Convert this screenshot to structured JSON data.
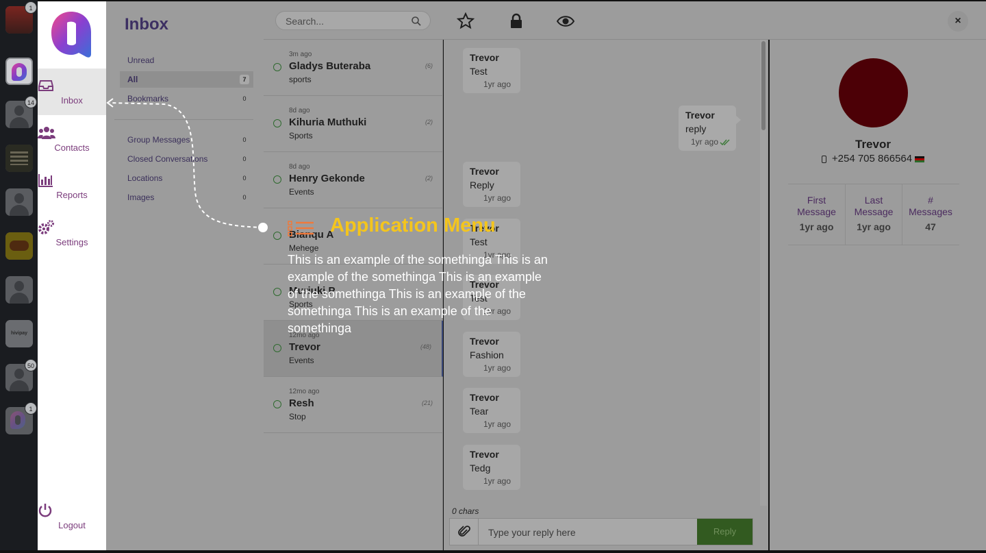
{
  "accounts": [
    {
      "badge": "1",
      "style": "red"
    },
    {
      "badge": "",
      "style": "active"
    },
    {
      "badge": "14",
      "style": "person"
    },
    {
      "badge": "",
      "style": "dark"
    },
    {
      "badge": "",
      "style": "person"
    },
    {
      "badge": "",
      "style": "yellow"
    },
    {
      "badge": "",
      "style": "person"
    },
    {
      "badge": "",
      "style": "txt",
      "text": "hivipay"
    },
    {
      "badge": "50",
      "style": "person"
    },
    {
      "badge": "1",
      "style": "dimlogo"
    }
  ],
  "nav": {
    "items": [
      {
        "label": "Inbox",
        "icon": "inbox-icon"
      },
      {
        "label": "Contacts",
        "icon": "users-icon"
      },
      {
        "label": "Reports",
        "icon": "bar-chart-icon"
      },
      {
        "label": "Settings",
        "icon": "gears-icon"
      }
    ],
    "logout": "Logout"
  },
  "filters": {
    "title": "Inbox",
    "primary": [
      {
        "label": "Unread",
        "count": ""
      },
      {
        "label": "All",
        "count": "7"
      },
      {
        "label": "Bookmarks",
        "count": "0"
      }
    ],
    "secondary": [
      {
        "label": "Group Messages",
        "count": "0"
      },
      {
        "label": "Closed Conversations",
        "count": "0"
      },
      {
        "label": "Locations",
        "count": "0"
      },
      {
        "label": "Images",
        "count": "0"
      }
    ]
  },
  "topbar": {
    "search_placeholder": "Search...",
    "close": "×"
  },
  "conversations": [
    {
      "ago": "3m ago",
      "name": "Gladys Buteraba",
      "tag": "sports",
      "count": "(6)"
    },
    {
      "ago": "8d ago",
      "name": "Kihuria Muthuki",
      "tag": "Sports",
      "count": "(2)"
    },
    {
      "ago": "8d ago",
      "name": "Henry Gekonde",
      "tag": "Events",
      "count": "(2)"
    },
    {
      "ago": "",
      "name": "Bianqu A",
      "tag": "Mehege",
      "count": ""
    },
    {
      "ago": "",
      "name": "Muriuki P",
      "tag": "Sports",
      "count": ""
    },
    {
      "ago": "12mo ago",
      "name": "Trevor",
      "tag": "Events",
      "count": "(48)"
    },
    {
      "ago": "12mo ago",
      "name": "Resh",
      "tag": "Stop",
      "count": "(21)"
    }
  ],
  "messages": [
    {
      "who": "Trevor",
      "text": "Test",
      "when": "1yr ago",
      "out": false
    },
    {
      "who": "Trevor",
      "text": "reply",
      "when": "1yr ago",
      "out": true
    },
    {
      "who": "Trevor",
      "text": "Reply",
      "when": "1yr ago",
      "out": false
    },
    {
      "who": "Trevor",
      "text": "Test",
      "when": "1yr ago",
      "out": false
    },
    {
      "who": "Trevor",
      "text": "Test",
      "when": "1yr ago",
      "out": false
    },
    {
      "who": "Trevor",
      "text": "Fashion",
      "when": "1yr ago",
      "out": false
    },
    {
      "who": "Trevor",
      "text": "Tear",
      "when": "1yr ago",
      "out": false
    },
    {
      "who": "Trevor",
      "text": "Tedg",
      "when": "1yr ago",
      "out": false
    }
  ],
  "composer": {
    "chars": "0 chars",
    "placeholder": "Type your reply here",
    "reply": "Reply"
  },
  "profile": {
    "name": "Trevor",
    "phone": "+254 705 866564",
    "stats": [
      {
        "label_line1": "First",
        "label_line2": "Message",
        "value": "1yr ago"
      },
      {
        "label_line1": "Last",
        "label_line2": "Message",
        "value": "1yr ago"
      },
      {
        "label_line1": "#",
        "label_line2": "Messages",
        "value": "47"
      }
    ]
  },
  "tour": {
    "title": "Application Menu",
    "body": "This is an example of the somethinga This is an example of the somethinga This is an example of the somethinga This is an example of the somethinga This is an example of the somethinga",
    "accent": "#f4c51d"
  }
}
